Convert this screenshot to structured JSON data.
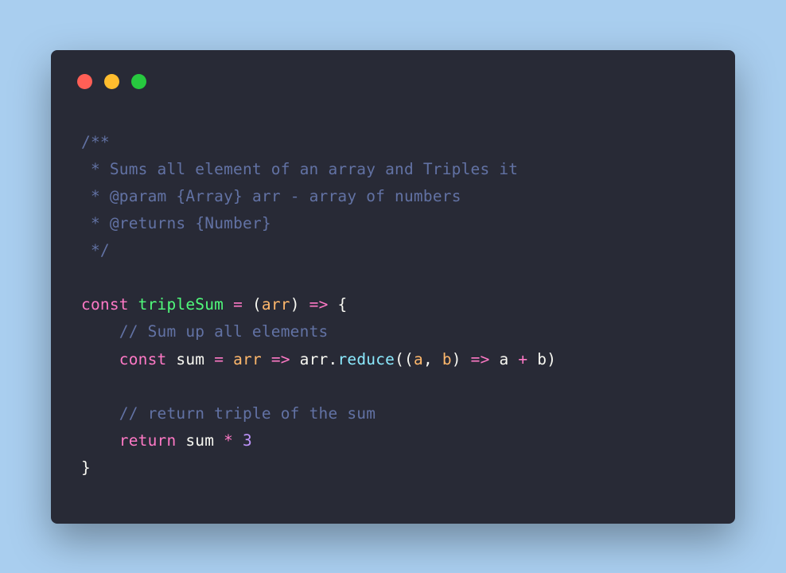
{
  "colors": {
    "background": "#a9ceef",
    "window": "#282a36",
    "trafficRed": "#ff5f56",
    "trafficYellow": "#ffbd2e",
    "trafficGreen": "#27c93f",
    "comment": "#6272a4",
    "keyword": "#ff79c6",
    "text": "#f8f8f2",
    "function": "#50fa7b",
    "param": "#ffb86c",
    "property": "#8be9fd",
    "number": "#bd93f9"
  },
  "code": {
    "line1": "/**",
    "line2": " * Sums all element of an array and Triples it",
    "line3_a": " * ",
    "line3_b": "@param",
    "line3_c": " ",
    "line3_d": "{Array}",
    "line3_e": " arr - array of numbers",
    "line4_a": " * ",
    "line4_b": "@returns",
    "line4_c": " ",
    "line4_d": "{Number}",
    "line5": " */",
    "line7_const": "const",
    "line7_space": " ",
    "line7_name": "tripleSum",
    "line7_eq": " = ",
    "line7_open": "(",
    "line7_param": "arr",
    "line7_close": ")",
    "line7_arrow": " => ",
    "line7_brace": "{",
    "line8_indent": "    ",
    "line8_comment": "// Sum up all elements",
    "line9_indent": "    ",
    "line9_const": "const",
    "line9_space": " ",
    "line9_name": "sum",
    "line9_eq": " = ",
    "line9_param1": "arr",
    "line9_arrow1": " => ",
    "line9_arr": "arr",
    "line9_dot": ".",
    "line9_reduce": "reduce",
    "line9_open": "((",
    "line9_a": "a",
    "line9_comma": ", ",
    "line9_b": "b",
    "line9_close1": ")",
    "line9_arrow2": " => ",
    "line9_a2": "a ",
    "line9_plus": "+",
    "line9_b2": " b",
    "line9_close2": ")",
    "line11_indent": "    ",
    "line11_comment": "// return triple of the sum",
    "line12_indent": "    ",
    "line12_return": "return",
    "line12_space": " ",
    "line12_sum": "sum ",
    "line12_mult": "*",
    "line12_space2": " ",
    "line12_three": "3",
    "line13": "}"
  }
}
